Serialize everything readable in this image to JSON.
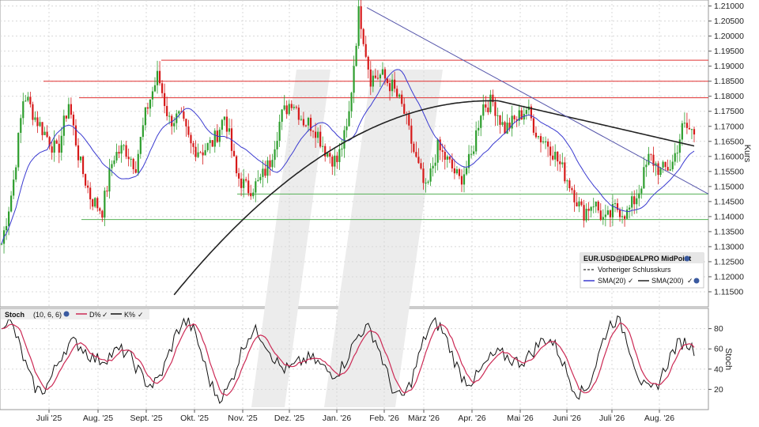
{
  "chart_data": [
    {
      "type": "candlestick",
      "instrument": "EUR.USD@IDEALPRO MidPoint",
      "ylabel": "Kurs",
      "ylim": [
        1.11,
        1.212
      ],
      "y_ticks": [
        "1.21000",
        "1.20500",
        "1.20000",
        "1.19500",
        "1.19000",
        "1.18500",
        "1.18000",
        "1.17500",
        "1.17000",
        "1.16500",
        "1.16000",
        "1.15500",
        "1.15000",
        "1.14500",
        "1.14000",
        "1.13500",
        "1.13000",
        "1.12500",
        "1.12000",
        "1.11500"
      ],
      "x_ticks": [
        "Juli '25",
        "Aug. '25",
        "Sept. '25",
        "Okt. '25",
        "Nov. '25",
        "Dez. '25",
        "Jan. '26",
        "Feb. '26",
        "März '26",
        "Apr. '26",
        "Mai '26",
        "Juni '26",
        "Juli '26",
        "Aug. '26"
      ],
      "legend": {
        "title": "EUR.USD@IDEALPRO MidPoint",
        "entries": [
          "Vorheriger Schlusskurs",
          "SMA(20)",
          "SMA(200)"
        ],
        "position": "bottom-right"
      },
      "close_path": [
        1.131,
        1.15,
        1.181,
        1.173,
        1.167,
        1.161,
        1.178,
        1.158,
        1.146,
        1.142,
        1.16,
        1.163,
        1.157,
        1.176,
        1.187,
        1.172,
        1.173,
        1.163,
        1.162,
        1.165,
        1.174,
        1.154,
        1.149,
        1.151,
        1.158,
        1.173,
        1.179,
        1.172,
        1.17,
        1.162,
        1.158,
        1.17,
        1.209,
        1.186,
        1.187,
        1.183,
        1.175,
        1.16,
        1.148,
        1.163,
        1.158,
        1.152,
        1.159,
        1.177,
        1.178,
        1.169,
        1.172,
        1.176,
        1.167,
        1.164,
        1.157,
        1.15,
        1.141,
        1.145,
        1.138,
        1.143,
        1.141,
        1.148,
        1.16,
        1.155,
        1.157,
        1.17,
        1.168
      ],
      "horizontal_levels": {
        "resistance": [
          1.192,
          1.185,
          1.1795
        ],
        "support": [
          1.1475,
          1.139
        ]
      },
      "trendline": {
        "from": [
          "Feb. '26",
          1.2095
        ],
        "to": [
          "Aug. '26",
          1.1475
        ]
      },
      "series": [
        {
          "name": "SMA(20)",
          "color": "#3a3ad0"
        },
        {
          "name": "SMA(200)",
          "color": "#222222"
        }
      ],
      "colors": {
        "up": "#2e9e2e",
        "down": "#d61a1a",
        "resistance": "#e03030",
        "support": "#55b055",
        "trend": "#5555aa"
      }
    },
    {
      "type": "line",
      "title": "Stoch",
      "params": "(10, 6, 6)",
      "ylabel": "Stoch",
      "ylim": [
        0,
        100
      ],
      "y_ticks": [
        "80",
        "60",
        "40",
        "20"
      ],
      "series": [
        {
          "name": "D%",
          "color": "#cc2a55"
        },
        {
          "name": "K%",
          "color": "#111111"
        }
      ]
    }
  ]
}
